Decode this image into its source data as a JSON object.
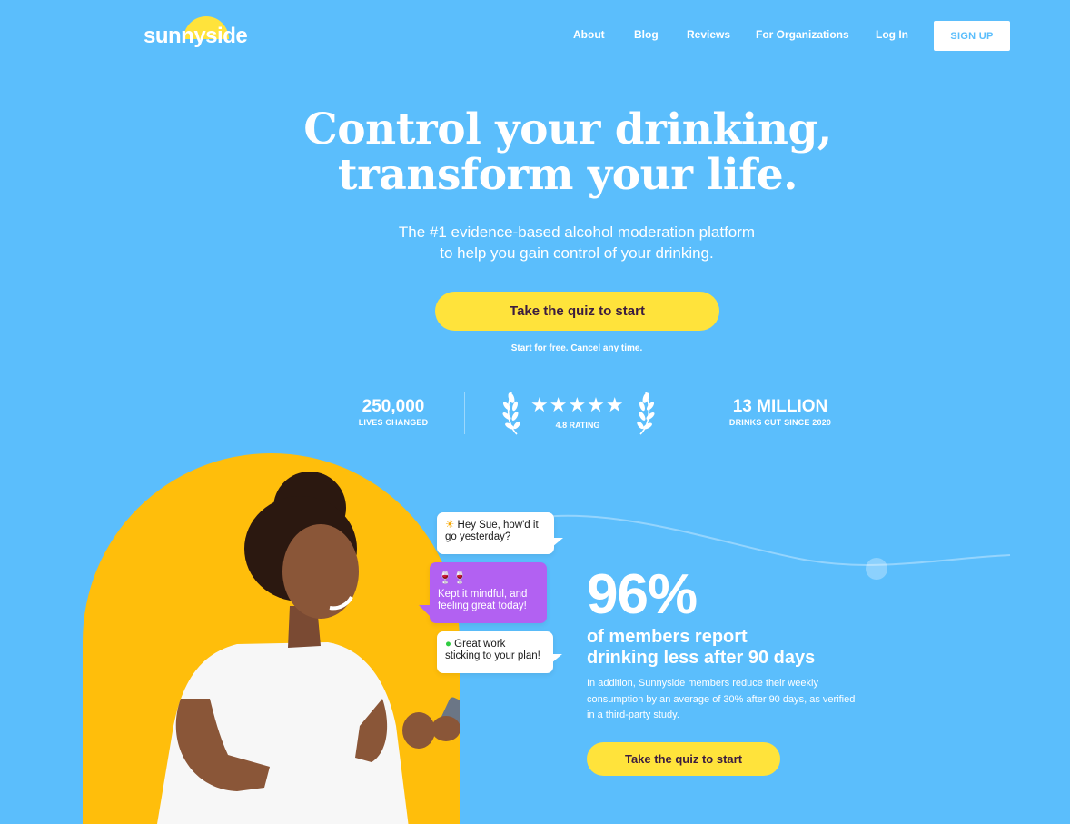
{
  "brand": {
    "logo_text": "sunnyside"
  },
  "nav": {
    "items": [
      "About",
      "Blog",
      "Reviews",
      "For Organizations",
      "Log In"
    ],
    "signup_label": "SIGN UP"
  },
  "hero": {
    "title_line1": "Control your drinking,",
    "title_line2": "transform your life.",
    "subtitle_line1": "The #1 evidence-based alcohol moderation platform",
    "subtitle_line2": "to help you gain control of your drinking.",
    "cta_label": "Take the quiz to start",
    "note": "Start for free. Cancel any time."
  },
  "stats": {
    "lives": {
      "value": "250,000",
      "label": "LIVES CHANGED"
    },
    "rating": {
      "stars": "★★★★★",
      "label": "4.8 RATING",
      "star_count": 5
    },
    "drinks": {
      "value": "13 MILLION",
      "label": "DRINKS CUT SINCE 2020"
    }
  },
  "chat": {
    "msg1_emoji": "☀",
    "msg1_line1": "Hey Sue, how'd it",
    "msg1_line2": "go yesterday?",
    "msg2_emoji": "🍷🍷",
    "msg2_line1": "Kept it mindful, and",
    "msg2_line2": "feeling great today!",
    "msg3_emoji": "●",
    "msg3_line1": "Great work",
    "msg3_line2": "sticking to your plan!"
  },
  "results": {
    "percent": "96%",
    "headline_line1": "of members report",
    "headline_line2": "drinking less after 90 days",
    "description": "In addition, Sunnyside members reduce their weekly consumption by an average of 30% after 90 days, as verified in a third-party study.",
    "cta_label": "Take the quiz to start"
  },
  "colors": {
    "background": "#5bbefc",
    "accent_yellow": "#ffe33b",
    "arch_yellow": "#ffbe0b",
    "bubble_purple": "#b261f2",
    "cta_text": "#3b1c3f"
  }
}
